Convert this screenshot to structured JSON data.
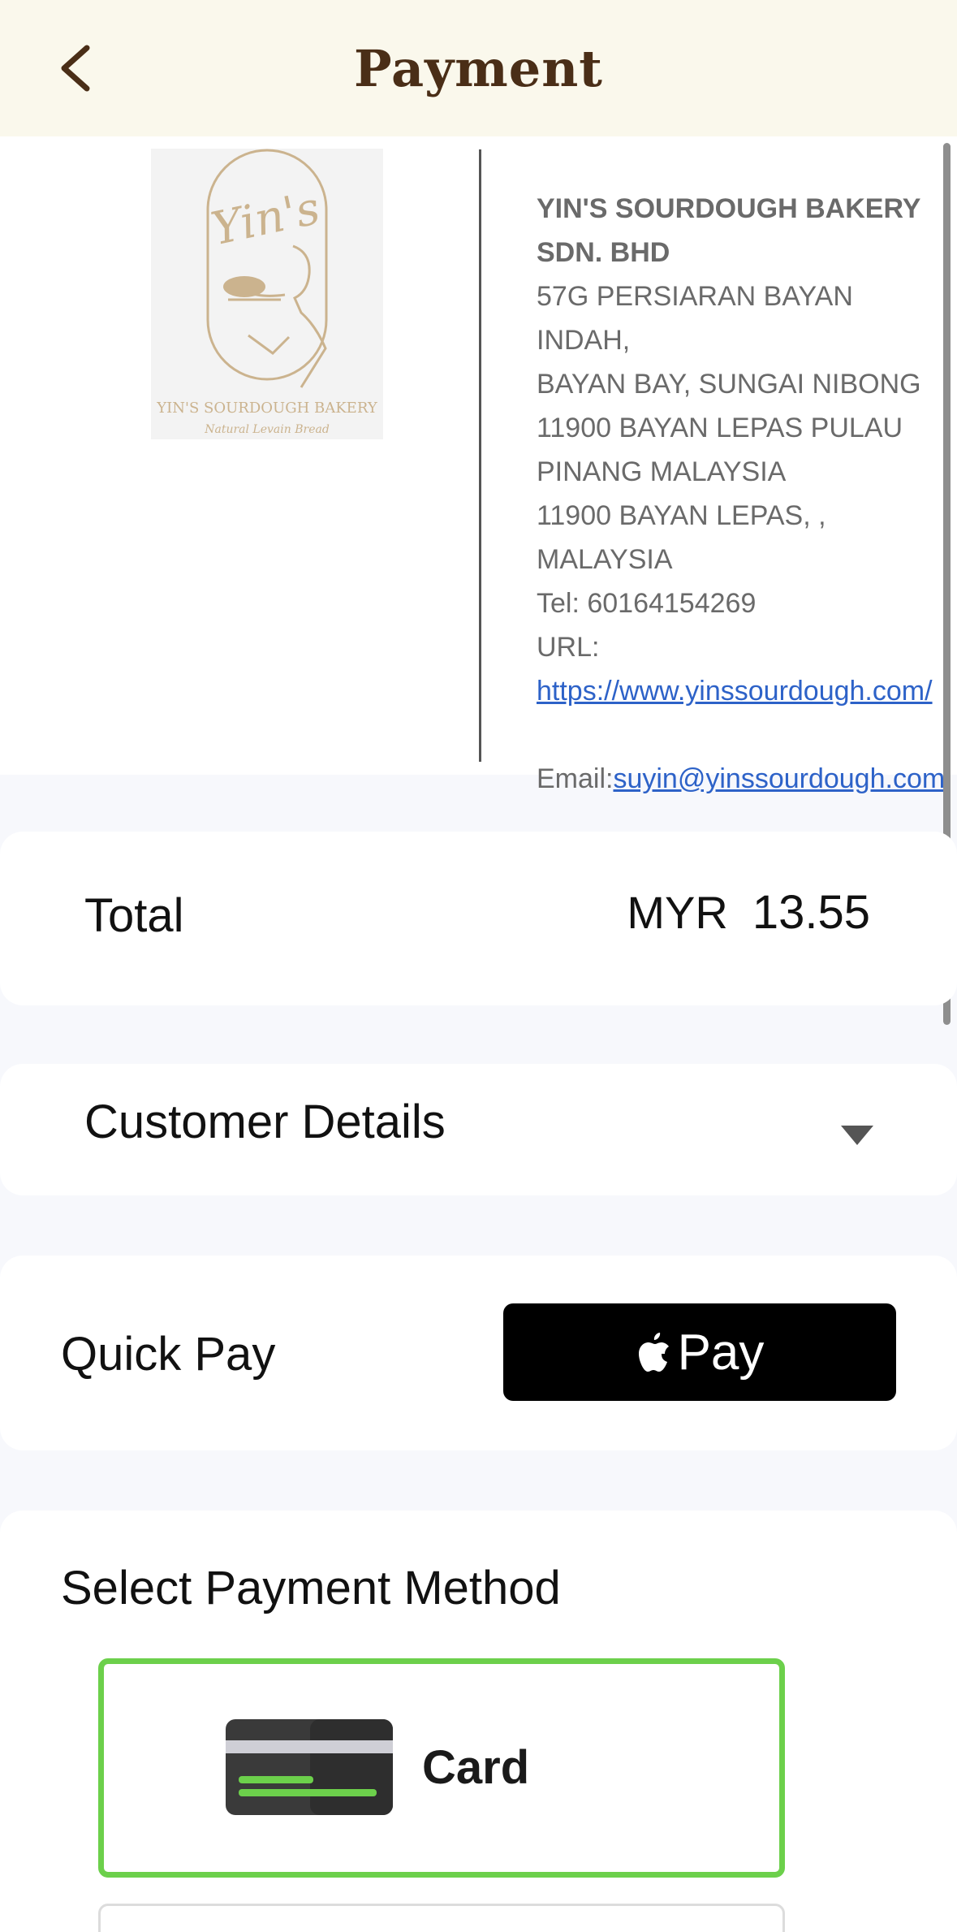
{
  "header": {
    "title": "Payment",
    "back_icon": "chevron-left-icon"
  },
  "merchant": {
    "logo_text": "Yin's",
    "logo_caption": "YIN'S SOURDOUGH BAKERY",
    "logo_tagline": "Natural Levain Bread",
    "name_line1": "YIN'S SOURDOUGH BAKERY",
    "name_line2": "SDN. BHD",
    "address_lines": [
      "57G PERSIARAN BAYAN INDAH,",
      "BAYAN BAY, SUNGAI NIBONG",
      "11900 BAYAN LEPAS PULAU",
      "PINANG MALAYSIA",
      "11900 BAYAN LEPAS, ,",
      "MALAYSIA"
    ],
    "tel": "Tel: 60164154269",
    "url_label": "URL:",
    "url": "https://www.yinssourdough.com/",
    "email_label": "Email:",
    "email": "suyin@yinssourdough.com"
  },
  "total": {
    "label": "Total",
    "currency": "MYR",
    "amount": "13.55"
  },
  "customer": {
    "label": "Customer Details",
    "icon": "caret-down-icon"
  },
  "quick_pay": {
    "label": "Quick Pay",
    "button_text": "Pay",
    "button_icon": "apple-logo-icon"
  },
  "payment_method": {
    "title": "Select Payment Method",
    "options": [
      {
        "label": "Card",
        "icon": "credit-card-icon",
        "selected": true
      }
    ]
  },
  "colors": {
    "header_bg": "#faf8ec",
    "title_color": "#4a2e17",
    "selected_border": "#6cd04b",
    "link": "#2d62c8",
    "logo_gold": "#cbb38e"
  }
}
